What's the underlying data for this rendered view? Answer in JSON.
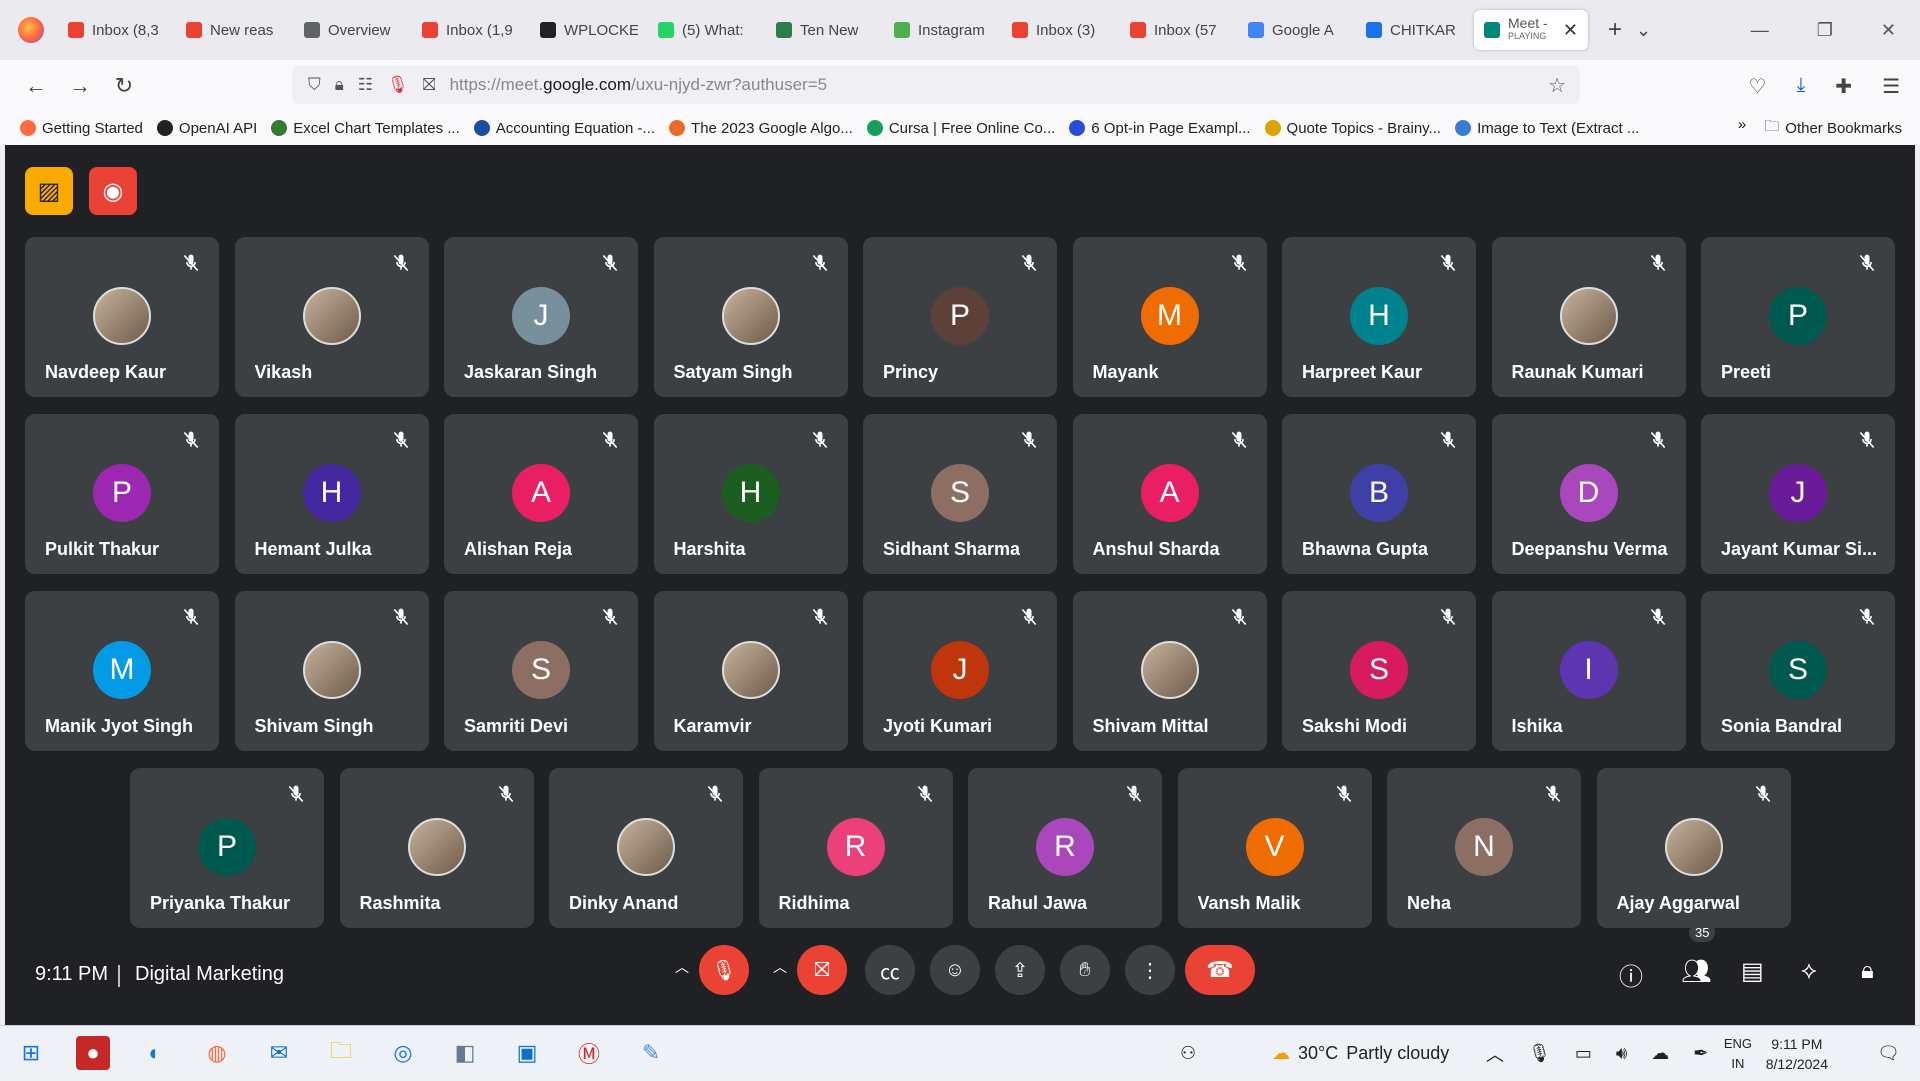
{
  "browser": {
    "tabs": [
      {
        "label": "Inbox (8,3",
        "icon": "gmail-icon",
        "color": "#ea4335"
      },
      {
        "label": "New reas",
        "icon": "gmail-icon",
        "color": "#ea4335"
      },
      {
        "label": "Overview",
        "icon": "overview-icon",
        "color": "#5f6368"
      },
      {
        "label": "Inbox (1,9",
        "icon": "gmail-icon",
        "color": "#ea4335"
      },
      {
        "label": "WPLOCKE",
        "icon": "wplocker-icon",
        "color": "#222222"
      },
      {
        "label": "(5) What:",
        "icon": "whatsapp-icon",
        "color": "#25d366"
      },
      {
        "label": "Ten New",
        "icon": "seo-icon",
        "color": "#2d7d46"
      },
      {
        "label": "Instagram",
        "icon": "instagram-icon",
        "color": "#4caf50"
      },
      {
        "label": "Inbox (3)",
        "icon": "gmail-icon",
        "color": "#ea4335"
      },
      {
        "label": "Inbox (57",
        "icon": "gmail-icon",
        "color": "#ea4335"
      },
      {
        "label": "Google A",
        "icon": "google-icon",
        "color": "#4285f4"
      },
      {
        "label": "CHITKAR",
        "icon": "calendar-icon",
        "color": "#1a73e8"
      }
    ],
    "active_tab": {
      "label": "Meet -",
      "sublabel": "PLAYING",
      "icon": "meet-icon"
    },
    "url_prefix": "https://meet.",
    "url_domain": "google.com",
    "url_path": "/uxu-njyd-zwr?authuser=5",
    "bookmarks": [
      {
        "label": "Getting Started",
        "color": "#ff6a3d"
      },
      {
        "label": "OpenAI API",
        "color": "#222222"
      },
      {
        "label": "Excel Chart Templates ...",
        "color": "#2e7d32"
      },
      {
        "label": "Accounting Equation -...",
        "color": "#1a4fa0"
      },
      {
        "label": "The 2023 Google Algo...",
        "color": "#e86a2c"
      },
      {
        "label": "Cursa | Free Online Co...",
        "color": "#18a058"
      },
      {
        "label": "6 Opt-in Page Exampl...",
        "color": "#2b4bd8"
      },
      {
        "label": "Quote Topics - Brainy...",
        "color": "#d9a400"
      },
      {
        "label": "Image to Text (Extract ...",
        "color": "#3a7bd5"
      }
    ],
    "other_bookmarks": "Other Bookmarks"
  },
  "meet": {
    "participants": [
      {
        "name": "Navdeep Kaur",
        "initial": "",
        "color": ""
      },
      {
        "name": "Vikash",
        "initial": "",
        "color": ""
      },
      {
        "name": "Jaskaran Singh",
        "initial": "J",
        "color": "#78909c"
      },
      {
        "name": "Satyam Singh",
        "initial": "",
        "color": ""
      },
      {
        "name": "Princy",
        "initial": "P",
        "color": "#5d4037"
      },
      {
        "name": "Mayank",
        "initial": "M",
        "color": "#ef6c00"
      },
      {
        "name": "Harpreet Kaur",
        "initial": "H",
        "color": "#00838f"
      },
      {
        "name": "Raunak Kumari",
        "initial": "",
        "color": ""
      },
      {
        "name": "Preeti",
        "initial": "P",
        "color": "#00594f"
      },
      {
        "name": "Pulkit Thakur",
        "initial": "P",
        "color": "#9c27b0"
      },
      {
        "name": "Hemant Julka",
        "initial": "H",
        "color": "#4527a0"
      },
      {
        "name": "Alishan Reja",
        "initial": "A",
        "color": "#e91e63"
      },
      {
        "name": "Harshita",
        "initial": "H",
        "color": "#1b5e20"
      },
      {
        "name": "Sidhant Sharma",
        "initial": "S",
        "color": "#8d6e63"
      },
      {
        "name": "Anshul Sharda",
        "initial": "A",
        "color": "#e91e63"
      },
      {
        "name": "Bhawna Gupta",
        "initial": "B",
        "color": "#3f3fa8"
      },
      {
        "name": "Deepanshu Verma",
        "initial": "D",
        "color": "#ab47bc"
      },
      {
        "name": "Jayant Kumar Si...",
        "initial": "J",
        "color": "#6a1b9a"
      },
      {
        "name": "Manik Jyot Singh",
        "initial": "M",
        "color": "#039be5"
      },
      {
        "name": "Shivam Singh",
        "initial": "",
        "color": ""
      },
      {
        "name": "Samriti Devi",
        "initial": "S",
        "color": "#8d6e63"
      },
      {
        "name": "Karamvir",
        "initial": "",
        "color": ""
      },
      {
        "name": "Jyoti Kumari",
        "initial": "J",
        "color": "#bf360c"
      },
      {
        "name": "Shivam Mittal",
        "initial": "",
        "color": ""
      },
      {
        "name": "Sakshi Modi",
        "initial": "S",
        "color": "#d81b60"
      },
      {
        "name": "Ishika",
        "initial": "I",
        "color": "#5e35b1"
      },
      {
        "name": "Sonia Bandral",
        "initial": "S",
        "color": "#00594f"
      },
      {
        "name": "Priyanka Thakur",
        "initial": "P",
        "color": "#00594f"
      },
      {
        "name": "Rashmita",
        "initial": "",
        "color": ""
      },
      {
        "name": "Dinky Anand",
        "initial": "",
        "color": ""
      },
      {
        "name": "Ridhima",
        "initial": "R",
        "color": "#ec407a"
      },
      {
        "name": "Rahul Jawa",
        "initial": "R",
        "color": "#ab47bc"
      },
      {
        "name": "Vansh Malik",
        "initial": "V",
        "color": "#ef6c00"
      },
      {
        "name": "Neha",
        "initial": "N",
        "color": "#8d6e63"
      },
      {
        "name": "Ajay Aggarwal",
        "initial": "",
        "color": ""
      }
    ],
    "time": "9:11 PM",
    "meeting_title": "Digital Marketing",
    "participant_count": "35"
  },
  "taskbar": {
    "weather": "30°C",
    "weather_desc": "Partly cloudy",
    "lang_line1": "ENG",
    "lang_line2": "IN",
    "time": "9:11 PM",
    "date": "8/12/2024"
  }
}
